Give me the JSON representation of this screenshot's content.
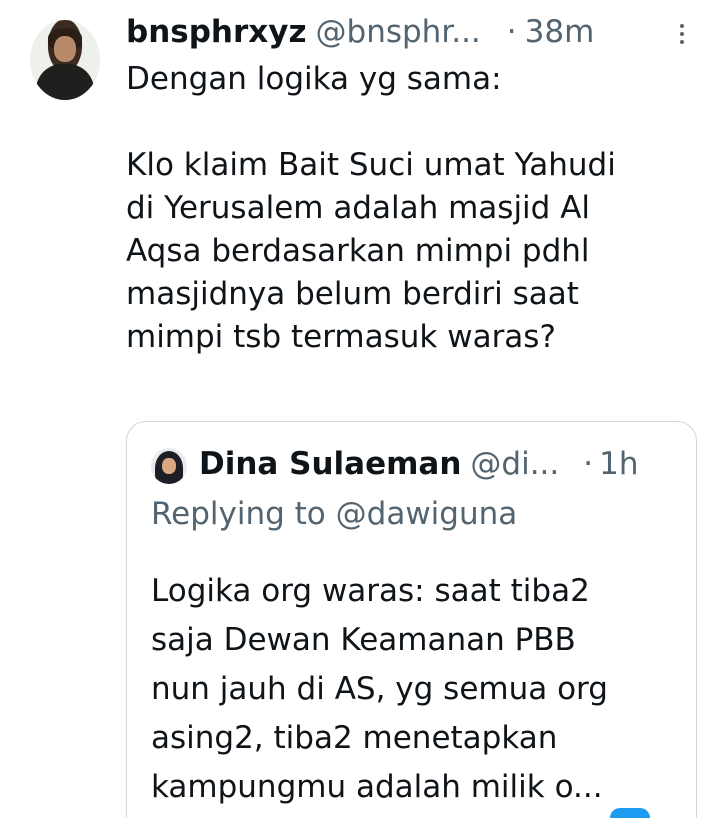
{
  "tweet": {
    "display_name": "bnsphrxyz",
    "handle": "@bnsphr...",
    "separator": "·",
    "time": "38m",
    "avatar_icon": "user-avatar",
    "more_icon": "more-options-icon",
    "text_line1": "Dengan logika yg sama:",
    "text_lines": [
      "Klo klaim Bait Suci umat Yahudi",
      "di Yerusalem adalah masjid Al",
      "Aqsa berdasarkan mimpi pdhl",
      "masjidnya belum berdiri saat",
      "mimpi tsb termasuk waras?"
    ]
  },
  "quote": {
    "display_name": "Dina Sulaeman",
    "handle": "@di...",
    "separator": "·",
    "time": "1h",
    "avatar_icon": "user-avatar",
    "replying_prefix": "Replying to",
    "replying_mention": "@dawiguna",
    "text_lines": [
      "Logika org waras: saat tiba2",
      "saja Dewan Keamanan PBB",
      "nun jauh di AS, yg semua org",
      "asing2, tiba2 menetapkan",
      "kampungmu adalah milik o..."
    ]
  },
  "colors": {
    "primary_text": "#0f1419",
    "secondary_text": "#536471",
    "border": "#cfd9de",
    "accent": "#1d9bf0"
  }
}
